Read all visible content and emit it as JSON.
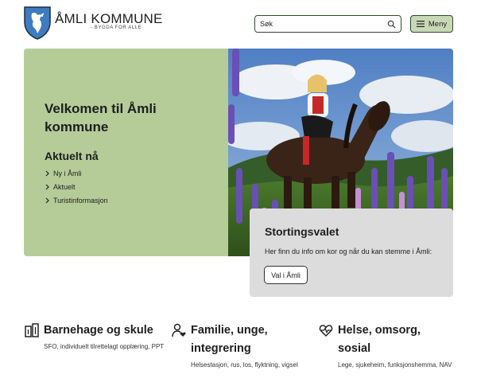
{
  "header": {
    "brand_title": "ÅMLI KOMMUNE",
    "brand_tagline": "- BYGDA FOR ALLE",
    "search": {
      "placeholder": "Søk",
      "value": ""
    },
    "menu_label": "Meny"
  },
  "hero": {
    "title": "Velkomen til Åmli kommune",
    "subheading": "Aktuelt nå",
    "links": [
      {
        "label": "Ny i Åmli"
      },
      {
        "label": "Aktuelt"
      },
      {
        "label": "Turistinformasjon"
      }
    ]
  },
  "callout": {
    "title": "Stortingsvalet",
    "text": "Her finn du info om kor og når du kan stemme i Åmli:",
    "button_label": "Val i Åmli"
  },
  "categories": [
    {
      "icon": "building-icon",
      "title": "Barnehage og skule",
      "desc": "SFO, individuelt tilrettelagt opplæring, PPT"
    },
    {
      "icon": "person-heart-icon",
      "title": "Familie, unge, integrering",
      "desc": "Helsestasjon, rus, los, flyktning, vigsel"
    },
    {
      "icon": "heart-pulse-icon",
      "title": "Helse, omsorg, sosial",
      "desc": "Lege, sjukeheim, funksjonshemma, NAV"
    }
  ],
  "colors": {
    "hero_green": "#b5cc99",
    "menu_green": "#c8d8b4",
    "callout_grey": "#dcdcdc",
    "border_dark_green": "#2f4a2a",
    "shield_blue": "#3d7cc0"
  }
}
